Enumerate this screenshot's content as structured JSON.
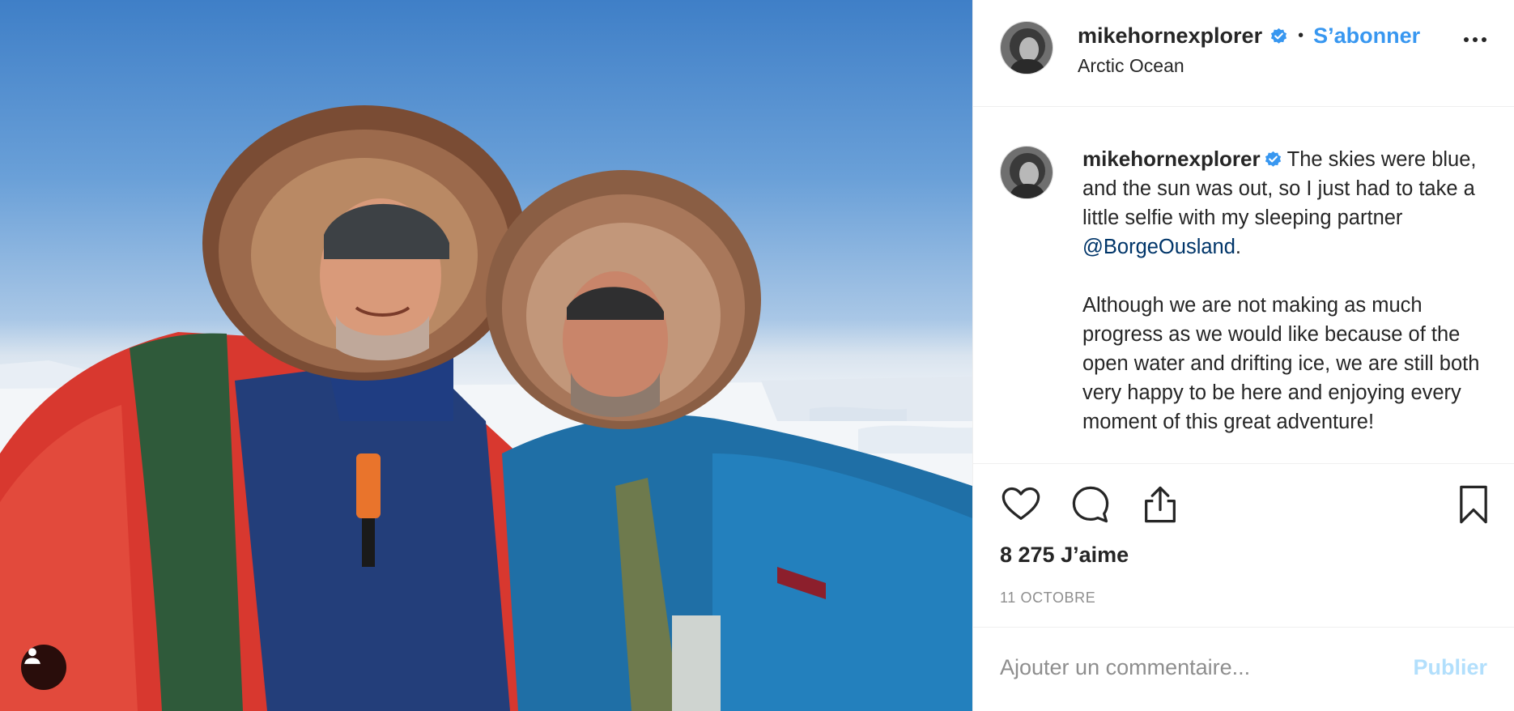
{
  "post": {
    "photo_alt": "",
    "username": "mikehornexplorer",
    "follow_label": "S’abonner",
    "separator": "•",
    "location": "Arctic Ocean",
    "caption": {
      "line1_text": "The skies were blue, and the sun was out, so I just had to take a little selfie with my sleeping partner ",
      "mention": "@BorgeOusland",
      "line1_end": ".",
      "paragraph2": "Although we are not making as much progress as we would like because of the open water and drifting ice, we are still both very happy to be here and enjoying every moment of this great adventure!"
    },
    "likes": "8 275 J’aime",
    "date": "11 OCTOBRE",
    "comment_placeholder": "Ajouter un commentaire...",
    "publish_label": "Publier"
  },
  "colors": {
    "link_blue": "#3897f0",
    "mention_blue": "#003569",
    "publish_disabled": "#b2dffc",
    "muted": "#8e8e8e"
  },
  "icons": [
    "user-tag-icon",
    "verified-badge-icon",
    "more-options-icon",
    "heart-icon",
    "comment-icon",
    "share-icon",
    "bookmark-icon"
  ]
}
